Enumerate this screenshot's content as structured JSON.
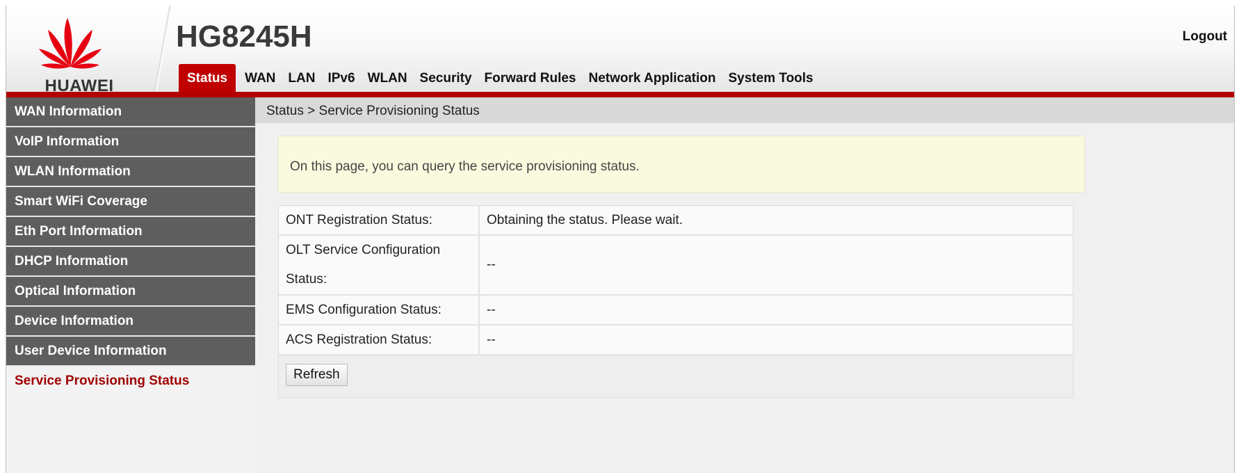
{
  "header": {
    "brand": "HUAWEI",
    "model": "HG8245H",
    "logout_label": "Logout"
  },
  "nav": {
    "tabs": [
      {
        "label": "Status",
        "active": true
      },
      {
        "label": "WAN"
      },
      {
        "label": "LAN"
      },
      {
        "label": "IPv6"
      },
      {
        "label": "WLAN"
      },
      {
        "label": "Security"
      },
      {
        "label": "Forward Rules"
      },
      {
        "label": "Network Application"
      },
      {
        "label": "System Tools"
      }
    ]
  },
  "sidebar": {
    "items": [
      {
        "label": "WAN Information"
      },
      {
        "label": "VoIP Information"
      },
      {
        "label": "WLAN Information"
      },
      {
        "label": "Smart WiFi Coverage"
      },
      {
        "label": "Eth Port Information"
      },
      {
        "label": "DHCP Information"
      },
      {
        "label": "Optical Information"
      },
      {
        "label": "Device Information"
      },
      {
        "label": "User Device Information"
      },
      {
        "label": "Service Provisioning Status",
        "active": true
      }
    ]
  },
  "main": {
    "breadcrumb": "Status > Service Provisioning Status",
    "info_text": "On this page, you can query the service provisioning status.",
    "rows": [
      {
        "label": "ONT Registration Status:",
        "value": "Obtaining the status. Please wait."
      },
      {
        "label": "OLT Service Configuration Status:",
        "value": "--"
      },
      {
        "label": "EMS Configuration Status:",
        "value": "--"
      },
      {
        "label": "ACS Registration Status:",
        "value": "--"
      }
    ],
    "refresh_label": "Refresh"
  },
  "colors": {
    "accent_red": "#c00000",
    "sidebar_bg": "#5e5e5e",
    "info_bg": "#fafade"
  }
}
